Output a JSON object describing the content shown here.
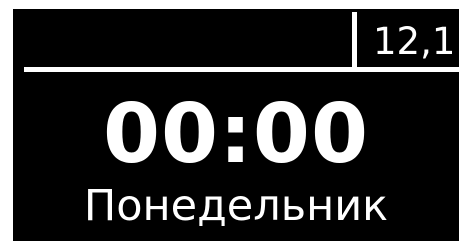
{
  "display": {
    "value_readout": "12,1",
    "time": "00:00",
    "day": "Понедельник"
  },
  "colors": {
    "background": "#000000",
    "foreground": "#ffffff",
    "outer_border": "#ffffff"
  }
}
